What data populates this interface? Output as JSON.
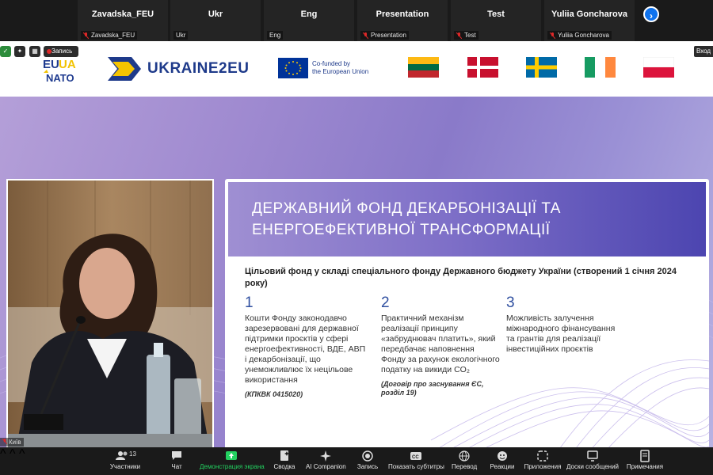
{
  "participants": [
    {
      "name": "Zavadska_FEU",
      "label": "Zavadska_FEU",
      "muted": true
    },
    {
      "name": "Ukr",
      "label": "Ukr",
      "muted": false
    },
    {
      "name": "Eng",
      "label": "Eng",
      "muted": false
    },
    {
      "name": "Presentation",
      "label": "Presentation",
      "muted": true
    },
    {
      "name": "Test",
      "label": "Test",
      "muted": true
    },
    {
      "name": "Yuliia Goncharova",
      "label": "Yuliia Goncharova",
      "muted": true
    }
  ],
  "share_controls": {
    "record_label": "Запись",
    "enter_label": "Вход"
  },
  "banner": {
    "logo_text": [
      "EU",
      "UA",
      "NATO"
    ],
    "u2eu_text": "UKRAINE2EU",
    "eu_text": [
      "Co-funded by",
      "the European Union"
    ],
    "flags": [
      "lithuania",
      "denmark",
      "sweden",
      "ireland",
      "poland"
    ]
  },
  "slide": {
    "title": "ДЕРЖАВНИЙ ФОНД ДЕКАРБОНІЗАЦІЇ ТА ЕНЕРГОЕФЕКТИВНОЇ ТРАНСФОРМАЦІЇ",
    "subtitle": "Цільовий фонд у складі спеціального фонду Державного бюджету України (створений 1 січня 2024 року)",
    "columns": [
      {
        "num": "1",
        "text": "Кошти Фонду законодавчо зарезервовані для державної підтримки проєктів у сфері енергоефективності, ВДЕ, АВП і декарбонізації, що унеможливлює їх нецільове використання",
        "note": "(КПКВК 0415020)"
      },
      {
        "num": "2",
        "text": "Практичний механізм реалізації принципу «забруднювач платить», який передбачає наповнення Фонду за рахунок екологічного податку на викиди CO₂",
        "note": "(Договір про заснування ЄС, розділ 19)"
      },
      {
        "num": "3",
        "text": "Можливість залучення міжнародного фінансування та грантів для реалізації інвестиційних проєктів",
        "note": ""
      }
    ]
  },
  "video_label": "Київ",
  "toolbar": {
    "participants_count": "13",
    "participants": "Участники",
    "chat": "Чат",
    "share": "Демонстрация экрана",
    "summary": "Сводка",
    "ai": "AI Companion",
    "record": "Запись",
    "captions": "Показать субтитры",
    "translate": "Перевод",
    "reactions": "Реакции",
    "apps": "Приложения",
    "whiteboards": "Доски сообщений",
    "notes": "Примечания"
  },
  "colors": {
    "accent": "#0e72ed",
    "share_green": "#23d160",
    "slide_header": "#4c45b0"
  }
}
